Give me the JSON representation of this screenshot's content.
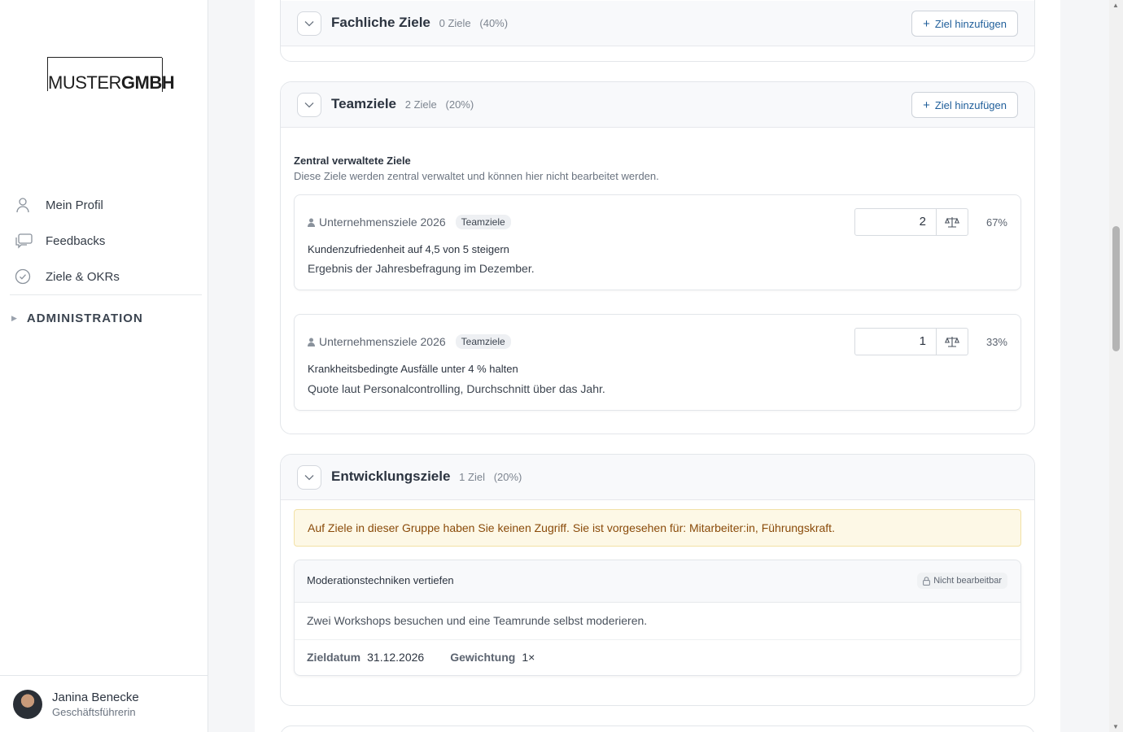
{
  "brand": {
    "logo_light": "MUSTER",
    "logo_bold": "GMBH"
  },
  "sidebar": {
    "items": [
      {
        "label": "Mein Profil",
        "icon": "user-icon"
      },
      {
        "label": "Feedbacks",
        "icon": "chat-icon"
      },
      {
        "label": "Ziele & OKRs",
        "icon": "check-circle-icon"
      }
    ],
    "admin_label": "ADMINISTRATION"
  },
  "user": {
    "name": "Janina Benecke",
    "role": "Geschäftsführerin"
  },
  "groups": {
    "fachliche": {
      "title": "Fachliche Ziele",
      "count": "0 Ziele",
      "share": "(40%)",
      "add_label": "Ziel hinzufügen"
    },
    "team": {
      "title": "Teamziele",
      "count": "2 Ziele",
      "share": "(20%)",
      "add_label": "Ziel hinzufügen",
      "central_title": "Zentral verwaltete Ziele",
      "central_sub": "Diese Ziele werden zentral verwaltet und können hier nicht bearbeitet werden.",
      "goals": [
        {
          "source": "Unternehmensziele 2026",
          "tag": "Teamziele",
          "title": "Kundenzufriedenheit auf 4,5 von 5 steigern",
          "description": "Ergebnis der Jahresbefragung im Dezember.",
          "weight": "2",
          "percent": "67%"
        },
        {
          "source": "Unternehmensziele 2026",
          "tag": "Teamziele",
          "title": "Krankheitsbedingte Ausfälle unter 4 % halten",
          "description": "Quote laut Personalcontrolling, Durchschnitt über das Jahr.",
          "weight": "1",
          "percent": "33%"
        }
      ]
    },
    "entwicklung": {
      "title": "Entwicklungsziele",
      "count": "1 Ziel",
      "share": "(20%)",
      "warning": "Auf Ziele in dieser Gruppe haben Sie keinen Zugriff. Sie ist vorgesehen für: Mitarbeiter:in, Führungskraft.",
      "goal": {
        "title": "Moderationstechniken vertiefen",
        "badge": "Nicht bearbeitbar",
        "description": "Zwei Workshops besuchen und eine Teamrunde selbst moderieren.",
        "date_label": "Zieldatum",
        "date_value": "31.12.2026",
        "weight_label": "Gewichtung",
        "weight_value": "1×"
      }
    }
  },
  "colors": {
    "link": "#1f5e9a",
    "warning_text": "#8a4b0a",
    "warning_bg": "#fdf8e6"
  }
}
